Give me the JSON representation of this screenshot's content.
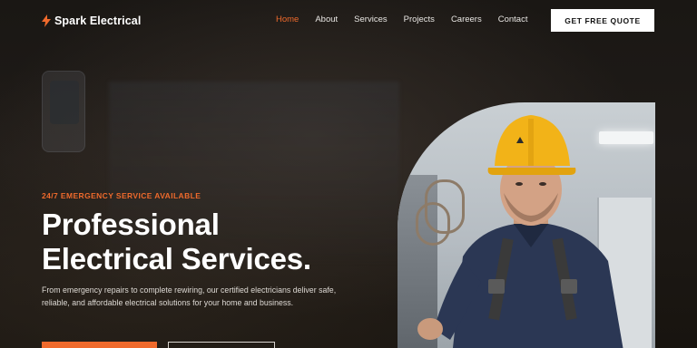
{
  "brand": {
    "name": "Spark Electrical",
    "accent": "#ef6a2c"
  },
  "nav": {
    "items": [
      {
        "label": "Home",
        "active": true
      },
      {
        "label": "About",
        "active": false
      },
      {
        "label": "Services",
        "active": false
      },
      {
        "label": "Projects",
        "active": false
      },
      {
        "label": "Careers",
        "active": false
      },
      {
        "label": "Contact",
        "active": false
      }
    ],
    "cta_label": "GET FREE QUOTE"
  },
  "hero": {
    "tagline": "24/7 EMERGENCY SERVICE AVAILABLE",
    "title_line1": "Professional",
    "title_line2": "Electrical Services.",
    "description": "From emergency repairs to complete rewiring, our certified electricians deliver safe, reliable, and affordable electrical solutions for your home and business."
  }
}
